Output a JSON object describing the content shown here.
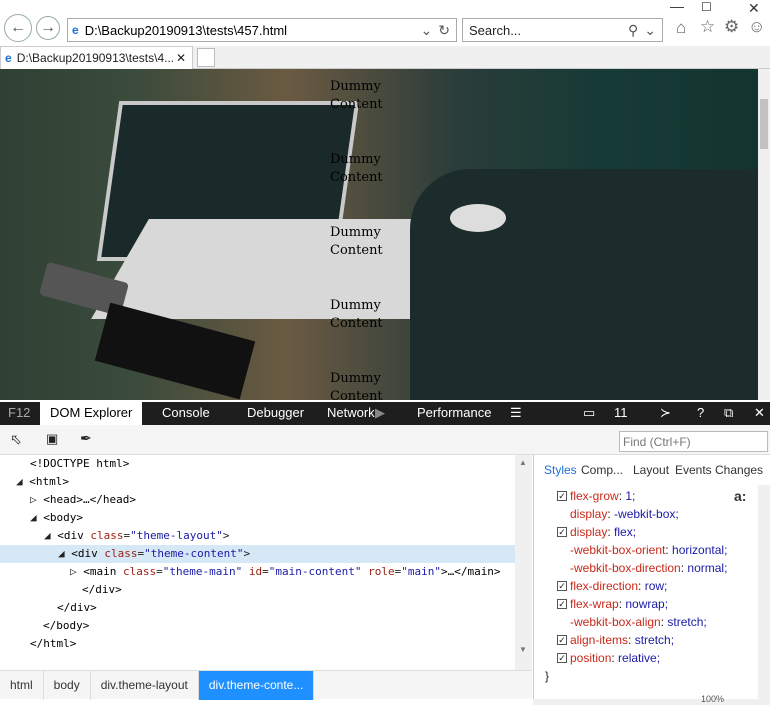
{
  "browser": {
    "url": "D:\\Backup20190913\\tests\\457.html",
    "search_placeholder": "Search...",
    "tab_title": "D:\\Backup20190913\\tests\\4..."
  },
  "page": {
    "dummy_lines": [
      "Dummy",
      "Content",
      "Dummy",
      "Content",
      "Dummy",
      "Content",
      "Dummy",
      "Content",
      "Dummy",
      "Content"
    ]
  },
  "devtools": {
    "tabs": {
      "f12": "F12",
      "dom": "DOM Explorer",
      "console": "Console",
      "debugger": "Debugger",
      "network": "Network",
      "performance": "Performance",
      "count": "11"
    },
    "find_placeholder": "Find (Ctrl+F)",
    "tree": {
      "doctype": "<!DOCTYPE html>",
      "html_open": "<html>",
      "head": "<head>…</head>",
      "body_open": "<body>",
      "div_layout_tag": "<div",
      "div_layout_attr": "class",
      "div_layout_val": "\"theme-layout\"",
      "div_content_tag": "<div",
      "div_content_attr": "class",
      "div_content_val": "\"theme-content\"",
      "main_tag": "<main",
      "main_class_attr": "class",
      "main_class_val": "\"theme-main\"",
      "main_id_attr": "id",
      "main_id_val": "\"main-content\"",
      "main_role_attr": "role",
      "main_role_val": "\"main\"",
      "main_end": ">…</main>",
      "div_close": "</div>",
      "div_close2": "</div>",
      "body_close": "</body>",
      "html_close": "</html>"
    },
    "style_tabs": {
      "styles": "Styles",
      "computed": "Comp...",
      "layout": "Layout",
      "events": "Events",
      "changes": "Changes"
    },
    "style_rules": [
      {
        "name": "flex-grow",
        "value": "1;",
        "checked": true
      },
      {
        "name": "display",
        "value": "-webkit-box;",
        "checked": false
      },
      {
        "name": "display",
        "value": "flex;",
        "checked": true
      },
      {
        "name": "-webkit-box-orient",
        "value": "horizontal;",
        "checked": false
      },
      {
        "name": "-webkit-box-direction",
        "value": "normal;",
        "checked": false
      },
      {
        "name": "flex-direction",
        "value": "row;",
        "checked": true
      },
      {
        "name": "flex-wrap",
        "value": "nowrap;",
        "checked": true
      },
      {
        "name": "-webkit-box-align",
        "value": "stretch;",
        "checked": false
      },
      {
        "name": "align-items",
        "value": "stretch;",
        "checked": true
      },
      {
        "name": "position",
        "value": "relative;",
        "checked": true
      }
    ],
    "closing_brace": "}",
    "breadcrumbs": [
      "html",
      "body",
      "div.theme-layout",
      "div.theme-conte..."
    ],
    "zoom": "100%"
  }
}
